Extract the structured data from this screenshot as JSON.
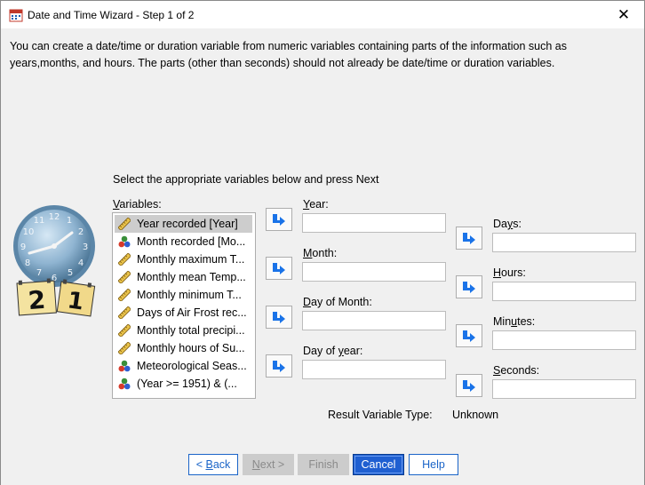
{
  "window": {
    "title": "Date and Time Wizard - Step 1 of 2",
    "close_glyph": "✕"
  },
  "intro_text": "You can create a date/time or duration variable from numeric variables containing parts of the information such as years,months, and hours. The parts (other than seconds) should not already be date/time or duration variables.",
  "instruction": "Select the appropriate variables below and press Next",
  "variables": {
    "label_mnemonic": "V",
    "label_rest": "ariables:",
    "items": [
      {
        "label": "Year recorded [Year]",
        "icon": "scale-ruler-icon",
        "selected": true
      },
      {
        "label": "Month recorded [Mo...",
        "icon": "nominal-balls-icon",
        "selected": false
      },
      {
        "label": "Monthly maximum T...",
        "icon": "scale-ruler-icon",
        "selected": false
      },
      {
        "label": "Monthly mean Temp...",
        "icon": "scale-ruler-icon",
        "selected": false
      },
      {
        "label": "Monthly minimum T...",
        "icon": "scale-ruler-icon",
        "selected": false
      },
      {
        "label": "Days of Air Frost rec...",
        "icon": "scale-ruler-icon",
        "selected": false
      },
      {
        "label": "Monthly total precipi...",
        "icon": "scale-ruler-icon",
        "selected": false
      },
      {
        "label": "Monthly hours of Su...",
        "icon": "scale-ruler-icon",
        "selected": false
      },
      {
        "label": "Meteorological Seas...",
        "icon": "nominal-balls-icon",
        "selected": false
      },
      {
        "label": "(Year  >= 1951) & (...",
        "icon": "nominal-balls-icon",
        "selected": false
      }
    ]
  },
  "fields_left": [
    {
      "mnemonic": "Y",
      "rest": "ear:",
      "value": ""
    },
    {
      "mnemonic": "M",
      "rest": "onth:",
      "value": ""
    },
    {
      "mnemonic": "D",
      "rest": "ay of Month:",
      "value": ""
    },
    {
      "pre": "Day of ",
      "mnemonic": "y",
      "rest": "ear:",
      "value": ""
    }
  ],
  "fields_right": [
    {
      "pre": "Da",
      "mnemonic": "y",
      "rest": "s:",
      "value": ""
    },
    {
      "mnemonic": "H",
      "rest": "ours:",
      "value": ""
    },
    {
      "pre": "Min",
      "mnemonic": "u",
      "rest": "tes:",
      "value": ""
    },
    {
      "mnemonic": "S",
      "rest": "econds:",
      "value": ""
    }
  ],
  "result": {
    "label": "Result Variable Type:",
    "value": "Unknown"
  },
  "buttons": {
    "back_prefix": "< ",
    "back_mnemonic": "B",
    "back_rest": "ack",
    "next_mnemonic": "N",
    "next_rest": "ext >",
    "finish": "Finish",
    "cancel": "Cancel",
    "help": "Help"
  },
  "colors": {
    "accent": "#1f5fd1",
    "arrow_blue": "#1a73e8"
  }
}
